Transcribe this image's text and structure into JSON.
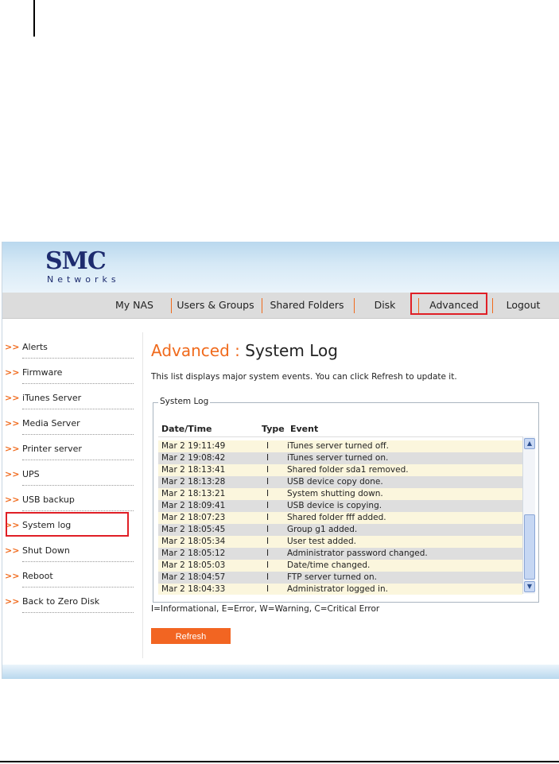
{
  "brand": {
    "name": "SMC",
    "subtitle": "Networks"
  },
  "nav": [
    {
      "label": "My NAS"
    },
    {
      "label": "Users & Groups"
    },
    {
      "label": "Shared Folders"
    },
    {
      "label": "Disk"
    },
    {
      "label": "Advanced",
      "active": true
    },
    {
      "label": "Logout"
    }
  ],
  "sidebar": {
    "items": [
      {
        "label": "Alerts"
      },
      {
        "label": "Firmware"
      },
      {
        "label": "iTunes Server"
      },
      {
        "label": "Media Server"
      },
      {
        "label": "Printer server"
      },
      {
        "label": "UPS"
      },
      {
        "label": "USB backup"
      },
      {
        "label": "System log",
        "active": true
      },
      {
        "label": "Shut Down"
      },
      {
        "label": "Reboot"
      },
      {
        "label": "Back to Zero Disk"
      }
    ],
    "arrow": ">>"
  },
  "page": {
    "title_section": "Advanced :",
    "title_page": "System Log",
    "description": "This list displays major system events. You can click Refresh to update it."
  },
  "log": {
    "legend": "System Log",
    "columns": {
      "date": "Date/Time",
      "type": "Type",
      "event": "Event"
    },
    "rows": [
      {
        "date": "Mar 2 19:11:49",
        "type": "I",
        "event": "iTunes server turned off."
      },
      {
        "date": "Mar 2 19:08:42",
        "type": "I",
        "event": "iTunes server turned on."
      },
      {
        "date": "Mar 2 18:13:41",
        "type": "I",
        "event": "Shared folder sda1 removed."
      },
      {
        "date": "Mar 2 18:13:28",
        "type": "I",
        "event": "USB device copy done."
      },
      {
        "date": "Mar 2 18:13:21",
        "type": "I",
        "event": "System shutting down."
      },
      {
        "date": "Mar 2 18:09:41",
        "type": "I",
        "event": "USB device is copying."
      },
      {
        "date": "Mar 2 18:07:23",
        "type": "I",
        "event": "Shared folder fff added."
      },
      {
        "date": "Mar 2 18:05:45",
        "type": "I",
        "event": "Group g1 added."
      },
      {
        "date": "Mar 2 18:05:34",
        "type": "I",
        "event": "User test added."
      },
      {
        "date": "Mar 2 18:05:12",
        "type": "I",
        "event": "Administrator password changed."
      },
      {
        "date": "Mar 2 18:05:03",
        "type": "I",
        "event": "Date/time changed."
      },
      {
        "date": "Mar 2 18:04:57",
        "type": "I",
        "event": "FTP server turned on."
      },
      {
        "date": "Mar 2 18:04:33",
        "type": "I",
        "event": "Administrator logged in."
      }
    ],
    "type_legend": "I=Informational, E=Error, W=Warning, C=Critical Error"
  },
  "actions": {
    "refresh_label": "Refresh"
  },
  "colors": {
    "accent": "#f26522",
    "highlight": "#e01f26",
    "brand": "#1d2b6e"
  }
}
